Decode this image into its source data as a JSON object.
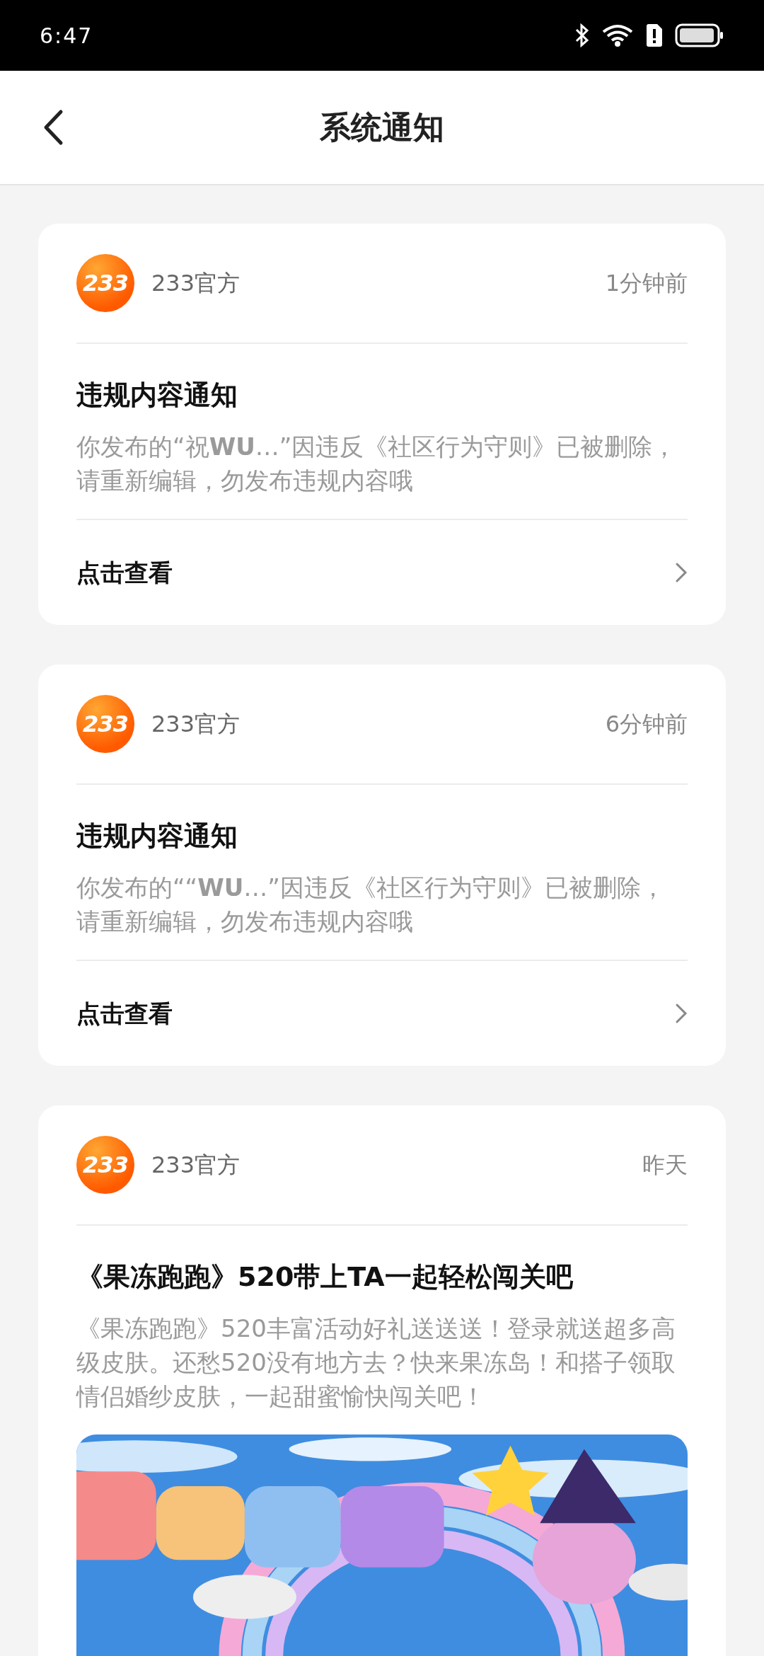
{
  "status_bar": {
    "time": "6:47"
  },
  "header": {
    "title": "系统通知"
  },
  "notifications": [
    {
      "kind": "notice",
      "logo_text": "233",
      "sender": "233官方",
      "time": "1分钟前",
      "title": "违规内容通知",
      "body": "你发布的“祝**WU**…”因违反《社区行为守则》已被删除，请重新编辑，勿发布违规内容哦",
      "action": "点击查看"
    },
    {
      "kind": "notice",
      "logo_text": "233",
      "sender": "233官方",
      "time": "6分钟前",
      "title": "违规内容通知",
      "body": "你发布的““**WU**…”因违反《社区行为守则》已被删除，请重新编辑，勿发布违规内容哦",
      "action": "点击查看"
    },
    {
      "kind": "promo",
      "logo_text": "233",
      "sender": "233官方",
      "time": "昨天",
      "title": "《果冻跑跑》520带上TA一起轻松闯关吧",
      "body": "《果冻跑跑》520丰富活动好礼送送送！登录就送超多高级皮肤。还愁520没有地方去？快来果冻岛！和搭子领取情侣婚纱皮肤，一起甜蜜愉快闯关吧！"
    }
  ]
}
